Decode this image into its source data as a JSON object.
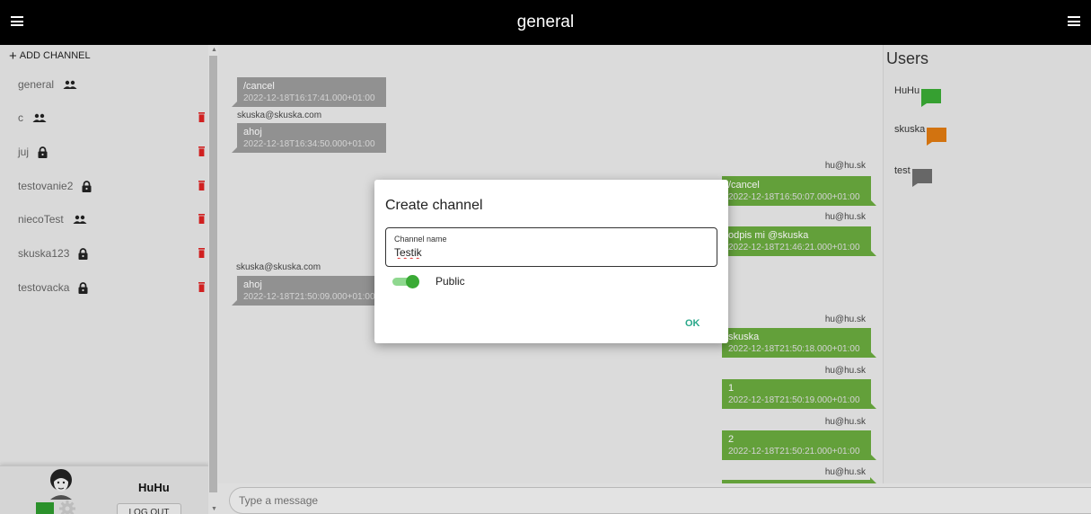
{
  "header": {
    "title": "general"
  },
  "sidebar": {
    "add_channel_label": "ADD CHANNEL",
    "channels": [
      {
        "name": "general",
        "type": "group-icon",
        "deletable": false
      },
      {
        "name": "c",
        "type": "group-icon",
        "deletable": true
      },
      {
        "name": "juj",
        "type": "lock-icon",
        "deletable": true
      },
      {
        "name": "testovanie2",
        "type": "lock-icon",
        "deletable": true
      },
      {
        "name": "niecoTest",
        "type": "group-icon",
        "deletable": true
      },
      {
        "name": "skuska123",
        "type": "lock-icon",
        "deletable": true
      },
      {
        "name": "testovacka",
        "type": "lock-icon",
        "deletable": true
      }
    ],
    "profile": {
      "name": "HuHu",
      "logout_label": "LOG OUT",
      "status_color": "#2e9b2e"
    }
  },
  "messages": [
    {
      "sender": "",
      "text": "/cancel",
      "time": "2022-12-18T16:17:41.000+01:00",
      "side": "left"
    },
    {
      "sender": "skuska@skuska.com",
      "text": "ahoj",
      "time": "2022-12-18T16:34:50.000+01:00",
      "side": "left"
    },
    {
      "sender": "hu@hu.sk",
      "text": "/cancel",
      "time": "2022-12-18T16:50:07.000+01:00",
      "side": "right"
    },
    {
      "sender": "hu@hu.sk",
      "text": "odpis mi @skuska",
      "time": "2022-12-18T21:46:21.000+01:00",
      "side": "right"
    },
    {
      "sender": "skuska@skuska.com",
      "text": "ahoj",
      "time": "2022-12-18T21:50:09.000+01:00",
      "side": "left"
    },
    {
      "sender": "hu@hu.sk",
      "text": "skuska",
      "time": "2022-12-18T21:50:18.000+01:00",
      "side": "right"
    },
    {
      "sender": "hu@hu.sk",
      "text": "1",
      "time": "2022-12-18T21:50:19.000+01:00",
      "side": "right"
    },
    {
      "sender": "hu@hu.sk",
      "text": "2",
      "time": "2022-12-18T21:50:21.000+01:00",
      "side": "right"
    },
    {
      "sender": "hu@hu.sk",
      "text": "",
      "time": "",
      "side": "right"
    }
  ],
  "users": {
    "title": "Users",
    "list": [
      {
        "name": "HuHu",
        "color": "#3aaa35"
      },
      {
        "name": "skuska",
        "color": "#e07b12"
      },
      {
        "name": "test",
        "color": "#6e6e6e"
      }
    ]
  },
  "composer": {
    "placeholder": "Type a message"
  },
  "dialog": {
    "title": "Create channel",
    "field_label": "Channel name",
    "field_value": "Testik",
    "toggle_label": "Public",
    "toggle_on": true,
    "ok_label": "OK"
  },
  "colors": {
    "accent_green": "#6aab3e",
    "bubble_gray": "#9b9b9b",
    "topbar": "#000000"
  }
}
